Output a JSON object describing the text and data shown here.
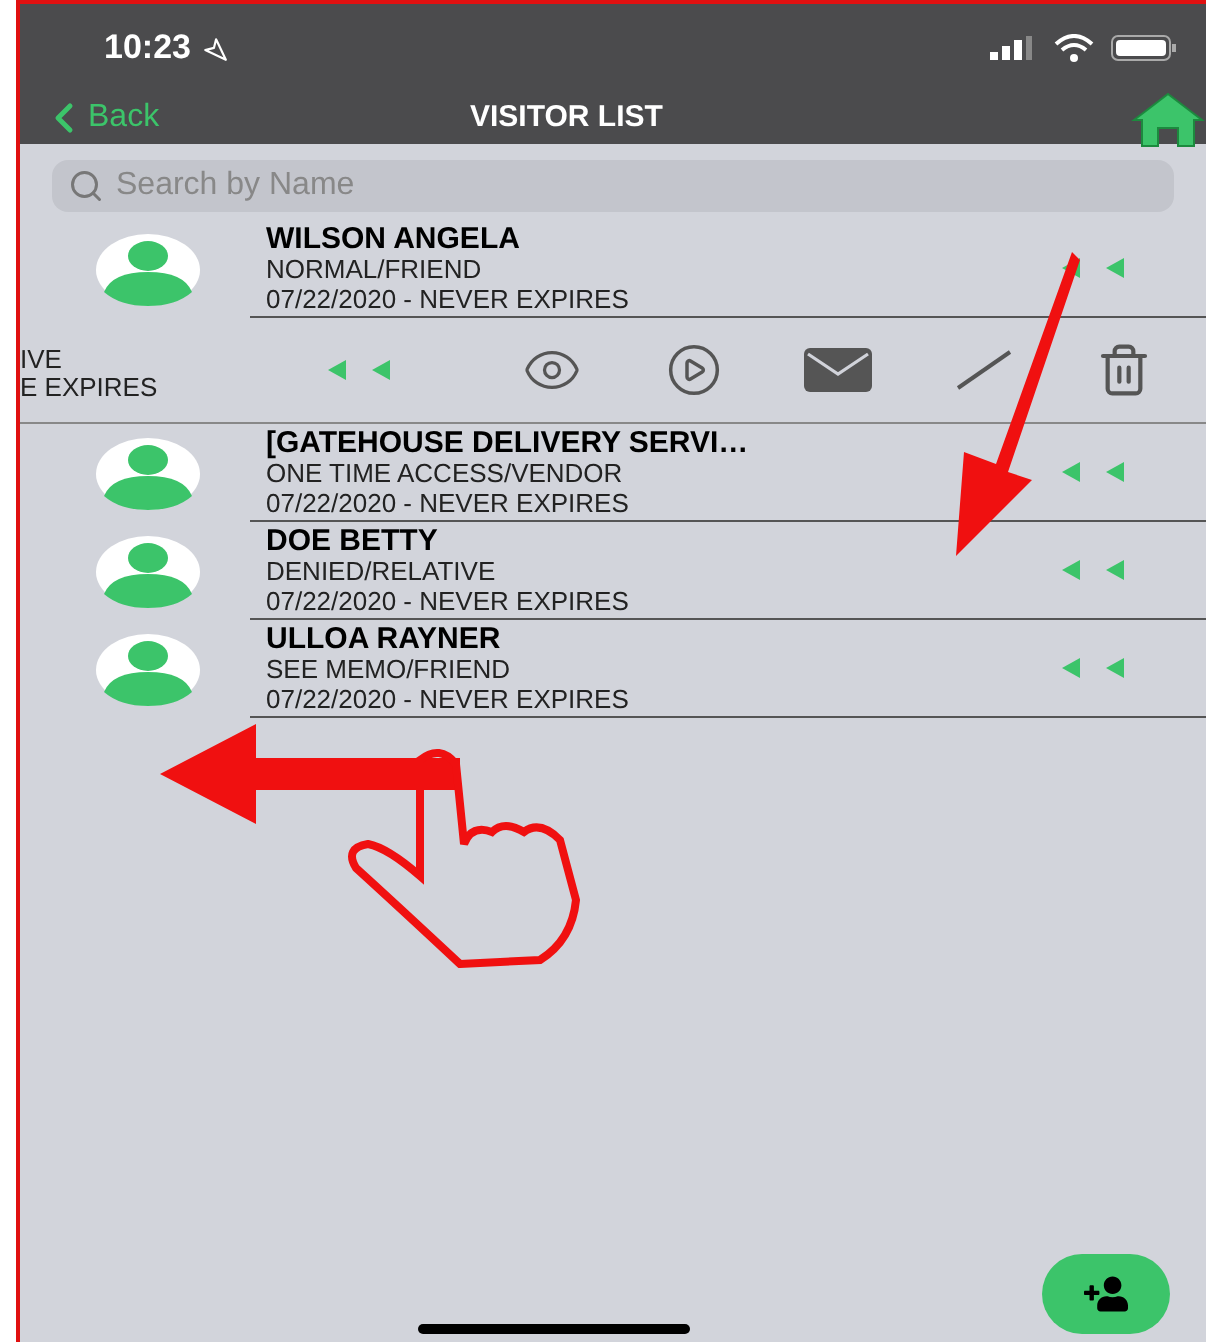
{
  "status_bar": {
    "time": "10:23"
  },
  "nav": {
    "back": "Back",
    "title": "VISITOR LIST"
  },
  "search": {
    "placeholder": "Search by Name"
  },
  "visitors": [
    {
      "kind": "row",
      "name": "WILSON ANGELA",
      "type": "NORMAL/FRIEND",
      "validity": "07/22/2020 - NEVER EXPIRES"
    },
    {
      "kind": "swiped",
      "type": "IVE",
      "validity": "E EXPIRES"
    },
    {
      "kind": "row",
      "name": "[GATEHOUSE DELIVERY SERVI…",
      "type": "ONE TIME ACCESS/VENDOR",
      "validity": "07/22/2020 - NEVER EXPIRES"
    },
    {
      "kind": "row",
      "name": "DOE BETTY",
      "type": "DENIED/RELATIVE",
      "validity": "07/22/2020 - NEVER EXPIRES"
    },
    {
      "kind": "row",
      "name": "ULLOA RAYNER",
      "type": "SEE MEMO/FRIEND",
      "validity": "07/22/2020 - NEVER EXPIRES"
    }
  ]
}
